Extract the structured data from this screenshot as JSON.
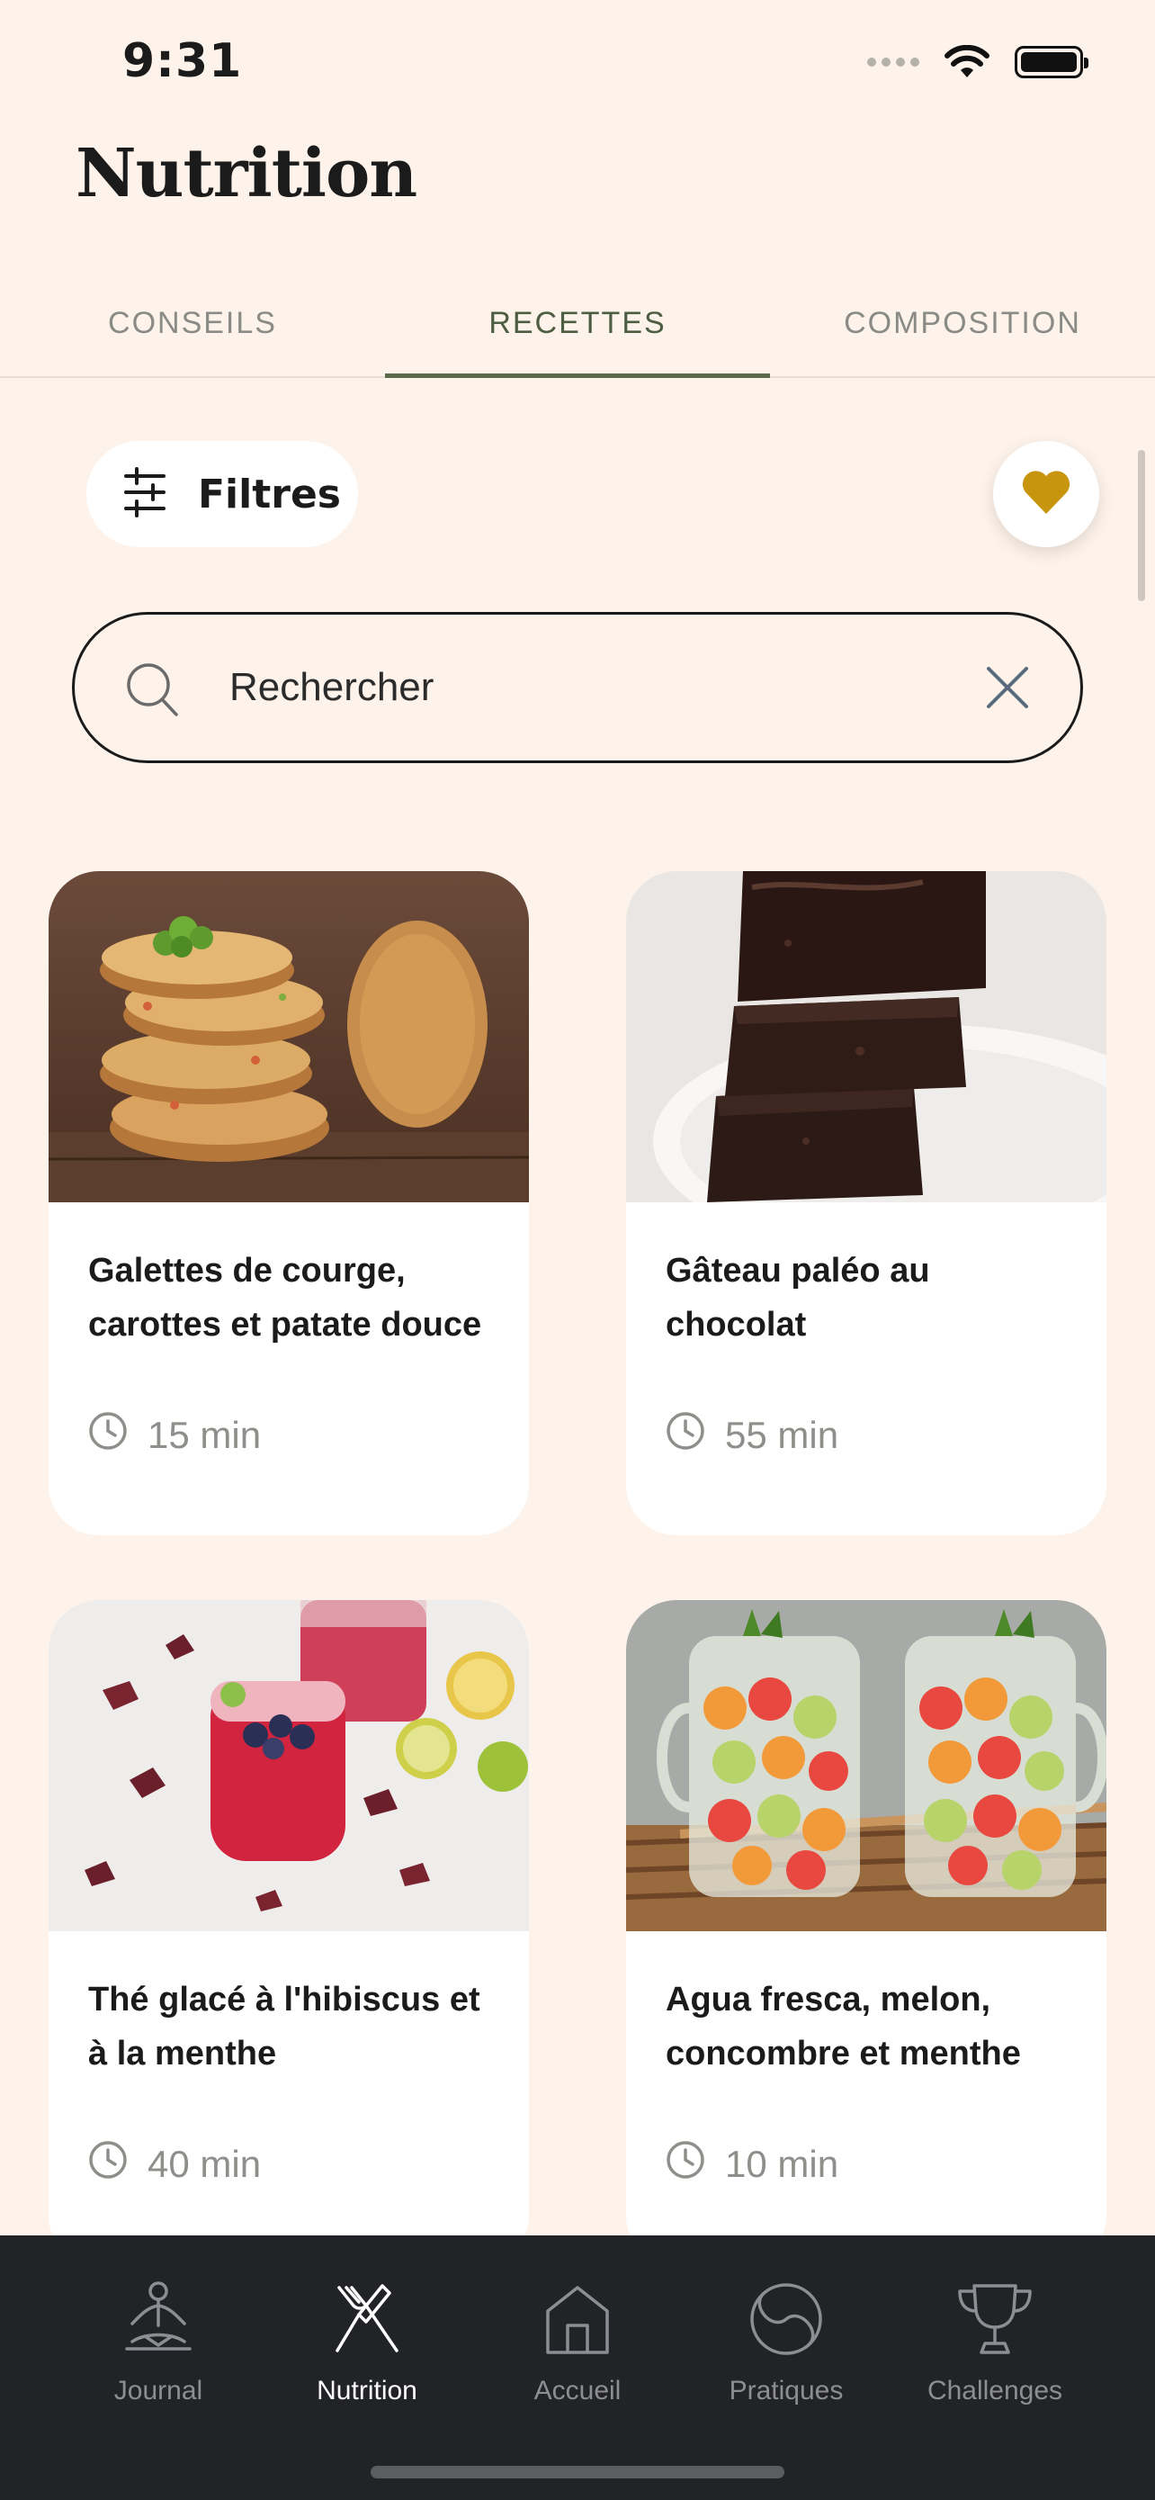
{
  "status": {
    "time": "9:31"
  },
  "header": {
    "title": "Nutrition"
  },
  "tabs": [
    {
      "label": "CONSEILS",
      "active": false
    },
    {
      "label": "RECETTES",
      "active": true
    },
    {
      "label": "COMPOSITION",
      "active": false
    }
  ],
  "toolbar": {
    "filters_label": "Filtres"
  },
  "search": {
    "placeholder": "Rechercher"
  },
  "recipes": [
    {
      "title": "Galettes de courge, carottes et patate douce",
      "time": "15 min"
    },
    {
      "title": "Gâteau paléo au chocolat",
      "time": "55 min"
    },
    {
      "title": "Thé glacé à l'hibiscus et à la menthe",
      "time": "40 min"
    },
    {
      "title": "Agua fresca, melon, concombre et menthe",
      "time": "10 min"
    }
  ],
  "tabbar": [
    {
      "label": "Journal",
      "icon": "meditation-icon",
      "active": false
    },
    {
      "label": "Nutrition",
      "icon": "fork-knife-icon",
      "active": true
    },
    {
      "label": "Accueil",
      "icon": "home-icon",
      "active": false
    },
    {
      "label": "Pratiques",
      "icon": "yin-yang-icon",
      "active": false
    },
    {
      "label": "Challenges",
      "icon": "trophy-icon",
      "active": false
    }
  ],
  "colors": {
    "background": "#fdf3ea",
    "accent": "#5a6a4c",
    "heart": "#c8960e",
    "tabbar": "#222326"
  }
}
